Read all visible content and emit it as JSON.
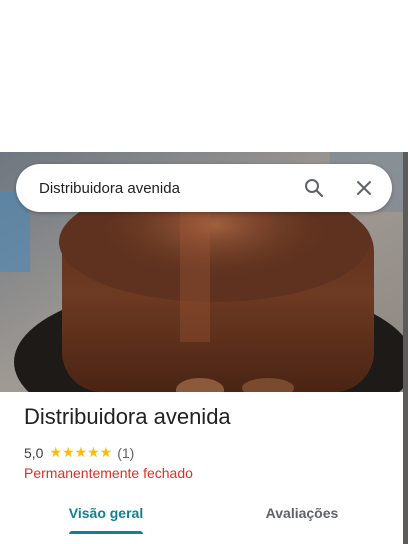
{
  "search": {
    "query": "Distribuidora avenida"
  },
  "place": {
    "name": "Distribuidora avenida",
    "rating_value": "5,0",
    "stars": "★★★★★",
    "review_count": "(1)",
    "status": "Permanentemente fechado"
  },
  "tabs": [
    {
      "label": "Visão geral",
      "selected": true
    },
    {
      "label": "Avaliações",
      "selected": false
    }
  ],
  "colors": {
    "accent": "#137f92",
    "status_closed": "#d93025",
    "star": "#fbbc04"
  },
  "icons": {
    "search": "search-icon",
    "close": "close-icon"
  }
}
